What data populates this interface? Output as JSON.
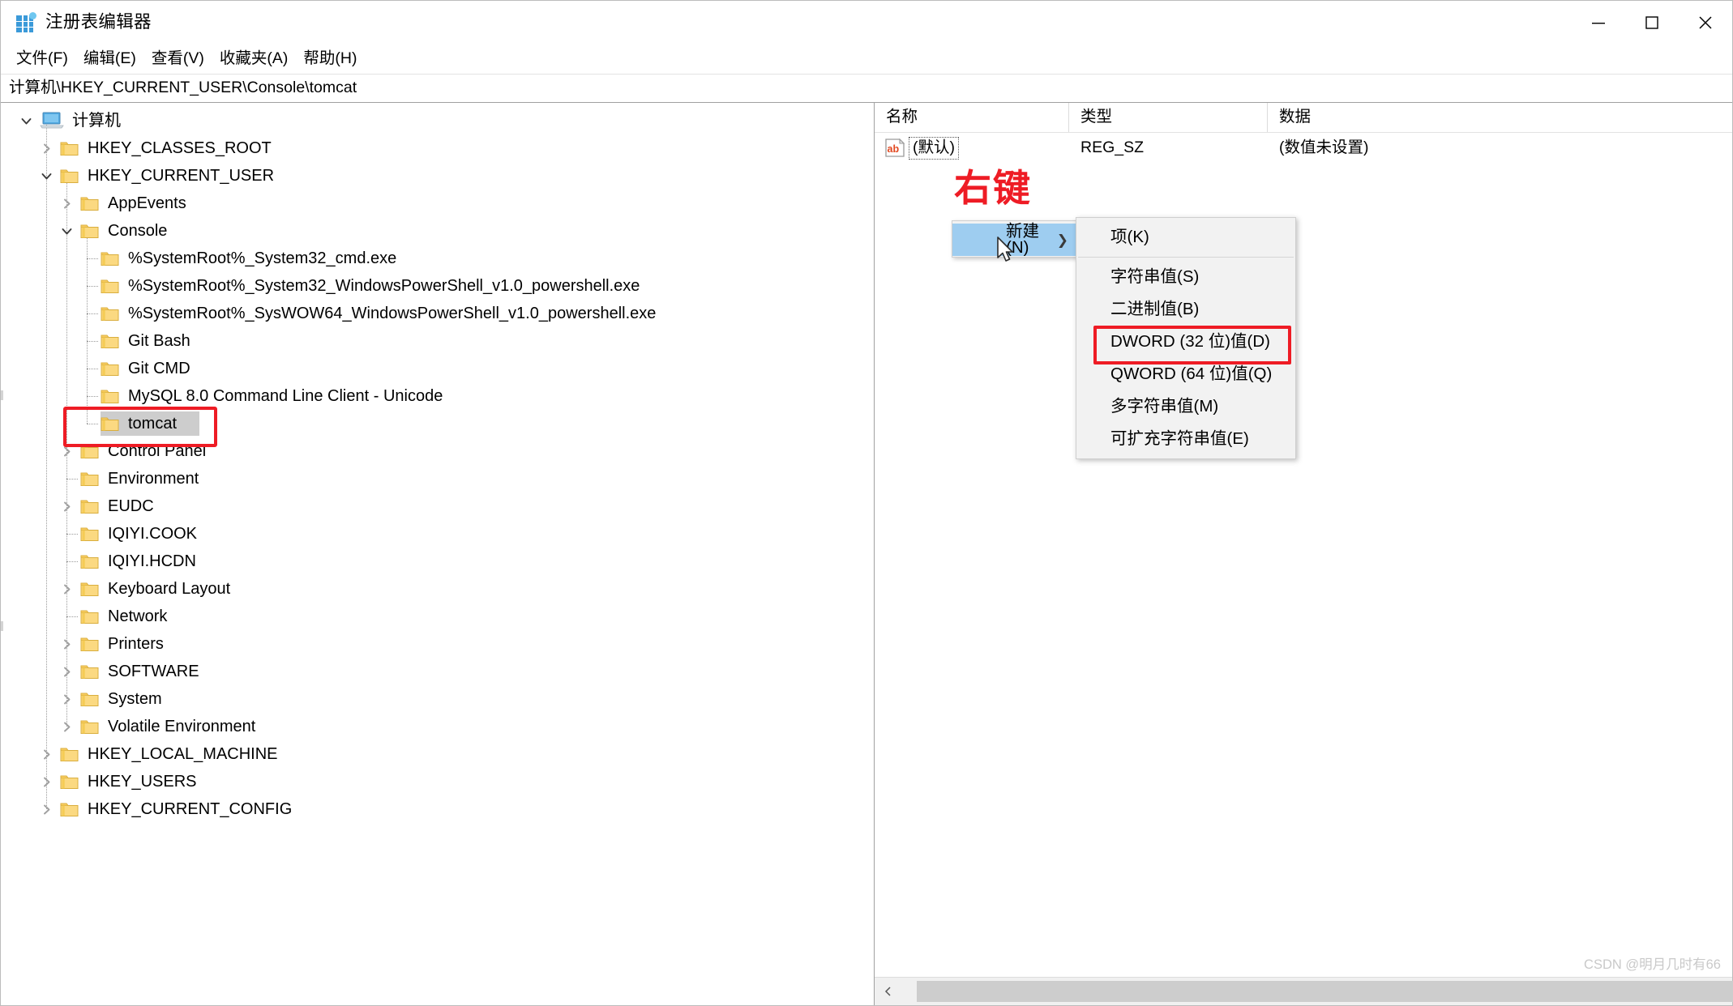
{
  "window": {
    "title": "注册表编辑器",
    "icon": "registry-editor-icon",
    "controls": {
      "minimize": "minimize-icon",
      "maximize": "maximize-icon",
      "close": "close-icon"
    }
  },
  "menubar": {
    "items": [
      {
        "label": "文件(F)",
        "name": "menu-file"
      },
      {
        "label": "编辑(E)",
        "name": "menu-edit"
      },
      {
        "label": "查看(V)",
        "name": "menu-view"
      },
      {
        "label": "收藏夹(A)",
        "name": "menu-favorites"
      },
      {
        "label": "帮助(H)",
        "name": "menu-help"
      }
    ]
  },
  "address": {
    "path": "计算机\\HKEY_CURRENT_USER\\Console\\tomcat"
  },
  "tree": {
    "items": [
      {
        "label": "计算机",
        "depth": 0,
        "expander": "expanded",
        "icon": "computer-icon"
      },
      {
        "label": "HKEY_CLASSES_ROOT",
        "depth": 1,
        "expander": "collapsed",
        "icon": "folder-icon"
      },
      {
        "label": "HKEY_CURRENT_USER",
        "depth": 1,
        "expander": "expanded",
        "icon": "folder-icon"
      },
      {
        "label": "AppEvents",
        "depth": 2,
        "expander": "collapsed",
        "icon": "folder-icon"
      },
      {
        "label": "Console",
        "depth": 2,
        "expander": "expanded",
        "icon": "folder-icon"
      },
      {
        "label": "%SystemRoot%_System32_cmd.exe",
        "depth": 3,
        "expander": "none",
        "icon": "folder-icon"
      },
      {
        "label": "%SystemRoot%_System32_WindowsPowerShell_v1.0_powershell.exe",
        "depth": 3,
        "expander": "none",
        "icon": "folder-icon"
      },
      {
        "label": "%SystemRoot%_SysWOW64_WindowsPowerShell_v1.0_powershell.exe",
        "depth": 3,
        "expander": "none",
        "icon": "folder-icon"
      },
      {
        "label": "Git Bash",
        "depth": 3,
        "expander": "none",
        "icon": "folder-icon"
      },
      {
        "label": "Git CMD",
        "depth": 3,
        "expander": "none",
        "icon": "folder-icon"
      },
      {
        "label": "MySQL 8.0 Command Line Client - Unicode",
        "depth": 3,
        "expander": "none",
        "icon": "folder-icon"
      },
      {
        "label": "tomcat",
        "depth": 3,
        "expander": "none",
        "icon": "folder-icon",
        "selected": true,
        "annotated": true
      },
      {
        "label": "Control Panel",
        "depth": 2,
        "expander": "collapsed",
        "icon": "folder-icon"
      },
      {
        "label": "Environment",
        "depth": 2,
        "expander": "none",
        "icon": "folder-icon"
      },
      {
        "label": "EUDC",
        "depth": 2,
        "expander": "collapsed",
        "icon": "folder-icon"
      },
      {
        "label": "IQIYI.COOK",
        "depth": 2,
        "expander": "none",
        "icon": "folder-icon"
      },
      {
        "label": "IQIYI.HCDN",
        "depth": 2,
        "expander": "none",
        "icon": "folder-icon"
      },
      {
        "label": "Keyboard Layout",
        "depth": 2,
        "expander": "collapsed",
        "icon": "folder-icon"
      },
      {
        "label": "Network",
        "depth": 2,
        "expander": "none",
        "icon": "folder-icon"
      },
      {
        "label": "Printers",
        "depth": 2,
        "expander": "collapsed",
        "icon": "folder-icon"
      },
      {
        "label": "SOFTWARE",
        "depth": 2,
        "expander": "collapsed",
        "icon": "folder-icon"
      },
      {
        "label": "System",
        "depth": 2,
        "expander": "collapsed",
        "icon": "folder-icon"
      },
      {
        "label": "Volatile Environment",
        "depth": 2,
        "expander": "collapsed",
        "icon": "folder-icon"
      },
      {
        "label": "HKEY_LOCAL_MACHINE",
        "depth": 1,
        "expander": "collapsed",
        "icon": "folder-icon"
      },
      {
        "label": "HKEY_USERS",
        "depth": 1,
        "expander": "collapsed",
        "icon": "folder-icon"
      },
      {
        "label": "HKEY_CURRENT_CONFIG",
        "depth": 1,
        "expander": "collapsed",
        "icon": "folder-icon"
      }
    ]
  },
  "values": {
    "columns": [
      {
        "label": "名称",
        "name": "column-name"
      },
      {
        "label": "类型",
        "name": "column-type"
      },
      {
        "label": "数据",
        "name": "column-data"
      }
    ],
    "rows": [
      {
        "icon": "string-value-icon",
        "name": "(默认)",
        "type": "REG_SZ",
        "data": "(数值未设置)"
      }
    ]
  },
  "annotations": {
    "right_click_label": "右键",
    "accent_color": "#ee1c25"
  },
  "context_menu": {
    "parent": {
      "label": "新建(N)",
      "submenu_arrow": "chevron-right-icon",
      "highlight_color": "#9ecdf0"
    },
    "submenu": [
      {
        "label": "项(K)",
        "name": "ctx-new-key"
      },
      {
        "separator": true
      },
      {
        "label": "字符串值(S)",
        "name": "ctx-new-string"
      },
      {
        "label": "二进制值(B)",
        "name": "ctx-new-binary"
      },
      {
        "label": "DWORD (32 位)值(D)",
        "name": "ctx-new-dword32",
        "annotated": true
      },
      {
        "label": "QWORD (64 位)值(Q)",
        "name": "ctx-new-qword64"
      },
      {
        "label": "多字符串值(M)",
        "name": "ctx-new-multistring"
      },
      {
        "label": "可扩充字符串值(E)",
        "name": "ctx-new-expandable-string"
      }
    ]
  },
  "scrollbar": {
    "left_arrow": "chevron-left-icon",
    "right_arrow": "chevron-right-icon"
  },
  "watermark": {
    "text": "CSDN @明月几时有66"
  }
}
